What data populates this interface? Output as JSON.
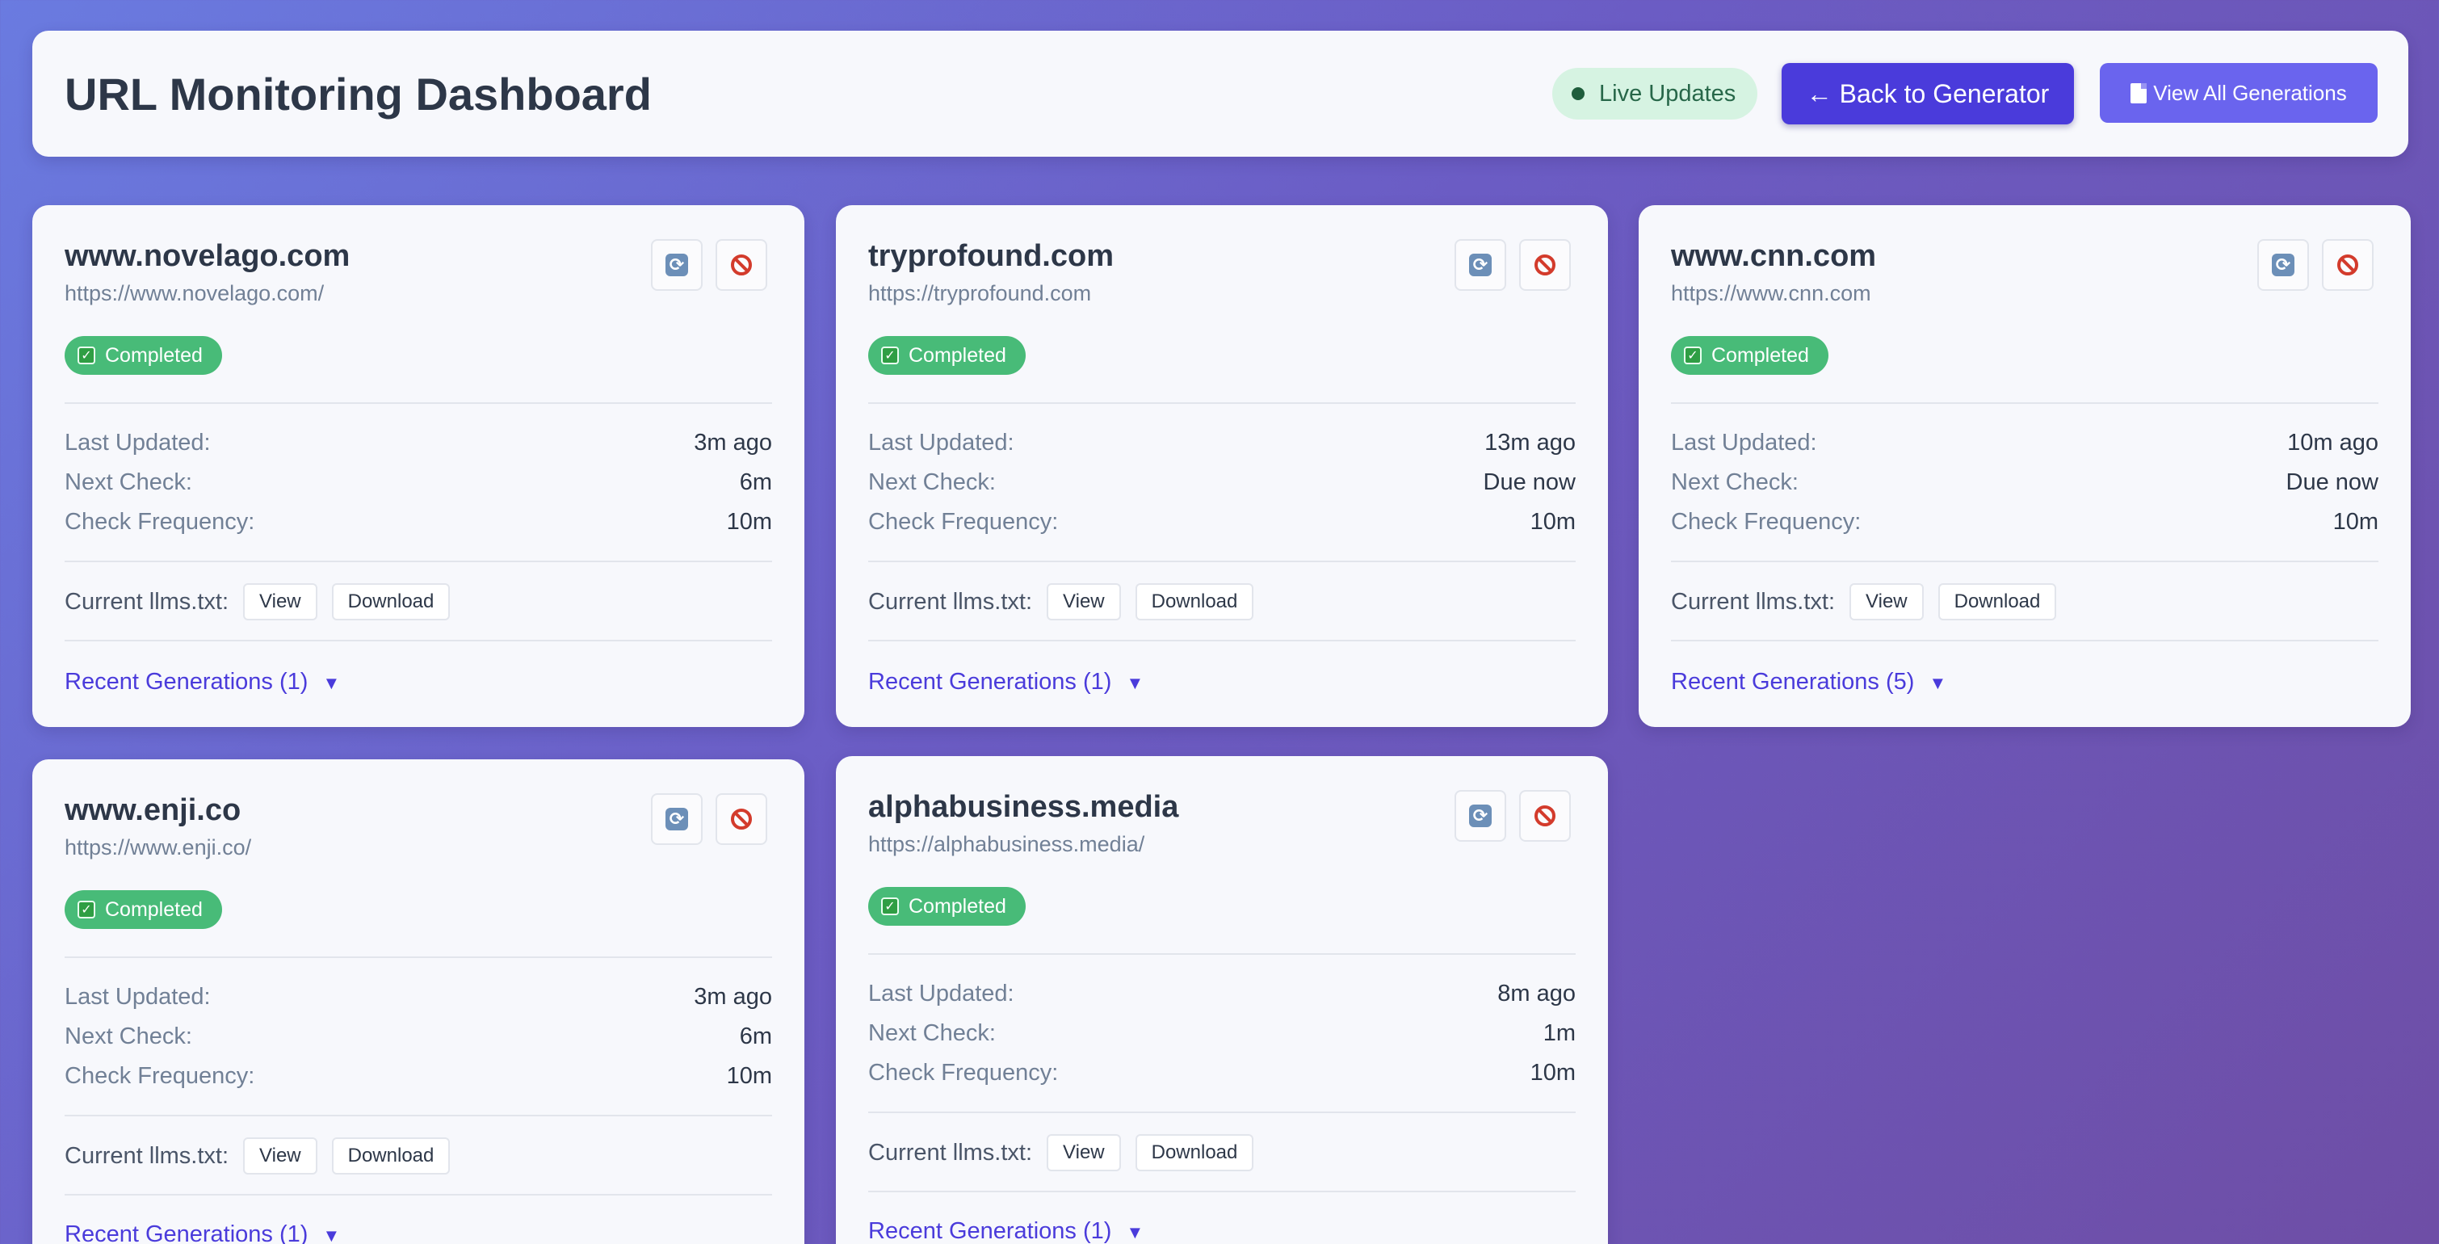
{
  "header": {
    "title": "URL Monitoring Dashboard",
    "live_label": "Live Updates",
    "back_label": "← Back to Generator",
    "view_all_label": "View All Generations"
  },
  "labels": {
    "last_updated": "Last Updated:",
    "next_check": "Next Check:",
    "check_frequency": "Check Frequency:",
    "current_llms": "Current llms.txt:",
    "view": "View",
    "download": "Download"
  },
  "cards": [
    {
      "site": "www.novelago.com",
      "url": "https://www.novelago.com/",
      "status": "Completed",
      "last_updated": "3m ago",
      "next_check": "6m",
      "frequency": "10m",
      "generations": "Recent Generations (1)"
    },
    {
      "site": "tryprofound.com",
      "url": "https://tryprofound.com",
      "status": "Completed",
      "last_updated": "13m ago",
      "next_check": "Due now",
      "frequency": "10m",
      "generations": "Recent Generations (1)"
    },
    {
      "site": "www.cnn.com",
      "url": "https://www.cnn.com",
      "status": "Completed",
      "last_updated": "10m ago",
      "next_check": "Due now",
      "frequency": "10m",
      "generations": "Recent Generations (5)"
    },
    {
      "site": "www.enji.co",
      "url": "https://www.enji.co/",
      "status": "Completed",
      "last_updated": "3m ago",
      "next_check": "6m",
      "frequency": "10m",
      "generations": "Recent Generations (1)"
    },
    {
      "site": "alphabusiness.media",
      "url": "https://alphabusiness.media/",
      "status": "Completed",
      "last_updated": "8m ago",
      "next_check": "1m",
      "frequency": "10m",
      "generations": "Recent Generations (1)"
    }
  ],
  "colors": {
    "accent": "#4a3bdb",
    "status_completed": "#48bb78",
    "live_badge_bg": "#d6f3e2"
  },
  "icons": {
    "refresh": "refresh-icon",
    "stop": "stop-monitoring-icon",
    "document": "document-icon",
    "expand": "chevron-down-icon",
    "status_check": "check-icon"
  }
}
